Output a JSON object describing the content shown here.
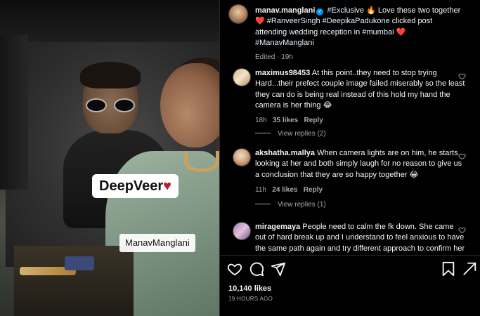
{
  "media": {
    "badge_text": "DeepVeer",
    "badge_heart": "♥",
    "watermark_text": "ManavManglani"
  },
  "post": {
    "author": "manav.manglani",
    "caption_segments": {
      "s1": "#Exclusive",
      "s2": " 🔥 Love these two together",
      "s3": "❤️",
      "s4": "#RanveerSingh",
      "s5": "#DeepikaPadukone",
      "s6": " clicked post attending wedding reception in ",
      "s7": "#mumbai",
      "s8": " ❤️",
      "s9": "#ManavManglani"
    },
    "edited_label": "Edited · 19h"
  },
  "comments": [
    {
      "username": "maximus98453",
      "text": "At this point..they need to stop trying Hard...their prefect couple image failed miserably so the least they can do is being real instead of this hold my hand the camera is her thing 😂",
      "time": "18h",
      "likes": "35 likes",
      "reply": "Reply",
      "view_replies": "View replies (2)"
    },
    {
      "username": "akshatha.mallya",
      "text": "When camera lights are on him, he starts looking at her and both simply laugh for no reason to give us a conclusion that they are so happy together 😂",
      "time": "11h",
      "likes": "24 likes",
      "reply": "Reply",
      "view_replies": "View replies (1)"
    },
    {
      "username": "miragemaya",
      "text": "People need to calm the fk down. She came out of hard break up and I understand to feel anxious to have the same path again and try different approach to confirm her feelings and whatnot.",
      "time": "",
      "likes": "",
      "reply": "",
      "view_replies": ""
    }
  ],
  "footer": {
    "likes": "10,140 likes",
    "time_ago": "19 HOURS AGO"
  },
  "icons": {
    "like": "heart-icon",
    "comment": "comment-icon",
    "share": "share-icon",
    "save": "bookmark-icon",
    "verified": "verified-icon"
  },
  "colors": {
    "background": "#000000",
    "text": "#f5f5f5",
    "muted": "#a8a8a8",
    "hashtag": "#e0f1ff",
    "verified": "#0095f6",
    "badge_heart": "#b3202a"
  }
}
